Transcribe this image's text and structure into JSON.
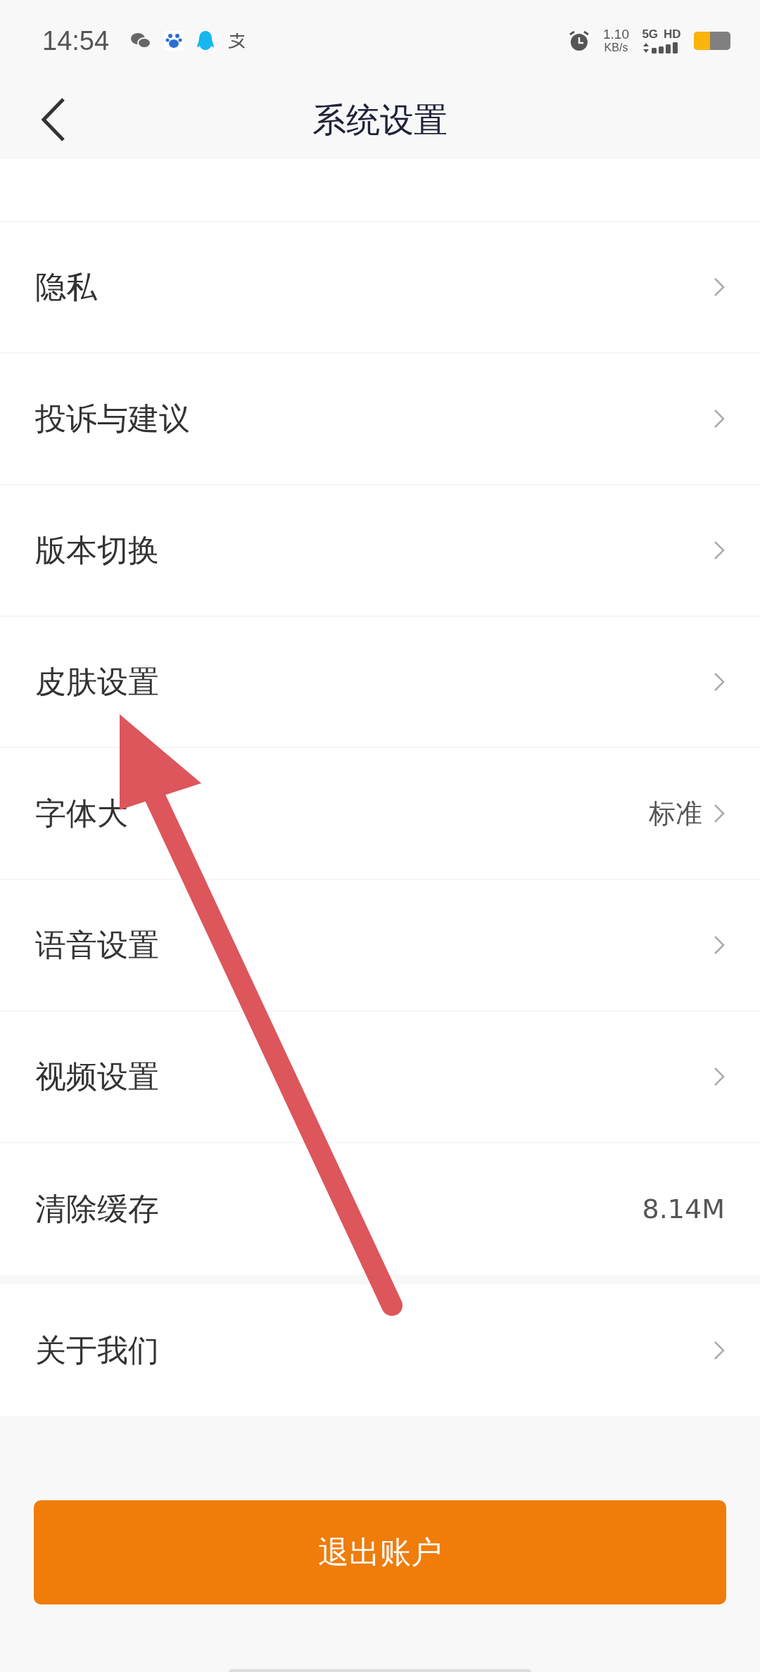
{
  "status_bar": {
    "time": "14:54",
    "speed": "1.10",
    "speed_unit": "KB/s",
    "network": "5G",
    "hd": "HD",
    "battery": {
      "level": 0.45
    }
  },
  "header": {
    "title": "系统设置"
  },
  "groups": [
    {
      "items": [
        {
          "label": "隐私",
          "chevron": true
        },
        {
          "label": "投诉与建议",
          "chevron": true
        },
        {
          "label": "版本切换",
          "chevron": true
        },
        {
          "label": "皮肤设置",
          "chevron": true
        },
        {
          "label": "字体大",
          "value": "标准",
          "chevron": true
        },
        {
          "label": "语音设置",
          "chevron": true
        },
        {
          "label": "视频设置",
          "chevron": true
        },
        {
          "label": "清除缓存",
          "value": "8.14M",
          "chevron": false
        }
      ]
    },
    {
      "items": [
        {
          "label": "关于我们",
          "chevron": true
        }
      ]
    }
  ],
  "logout_button": {
    "label": "退出账户"
  }
}
